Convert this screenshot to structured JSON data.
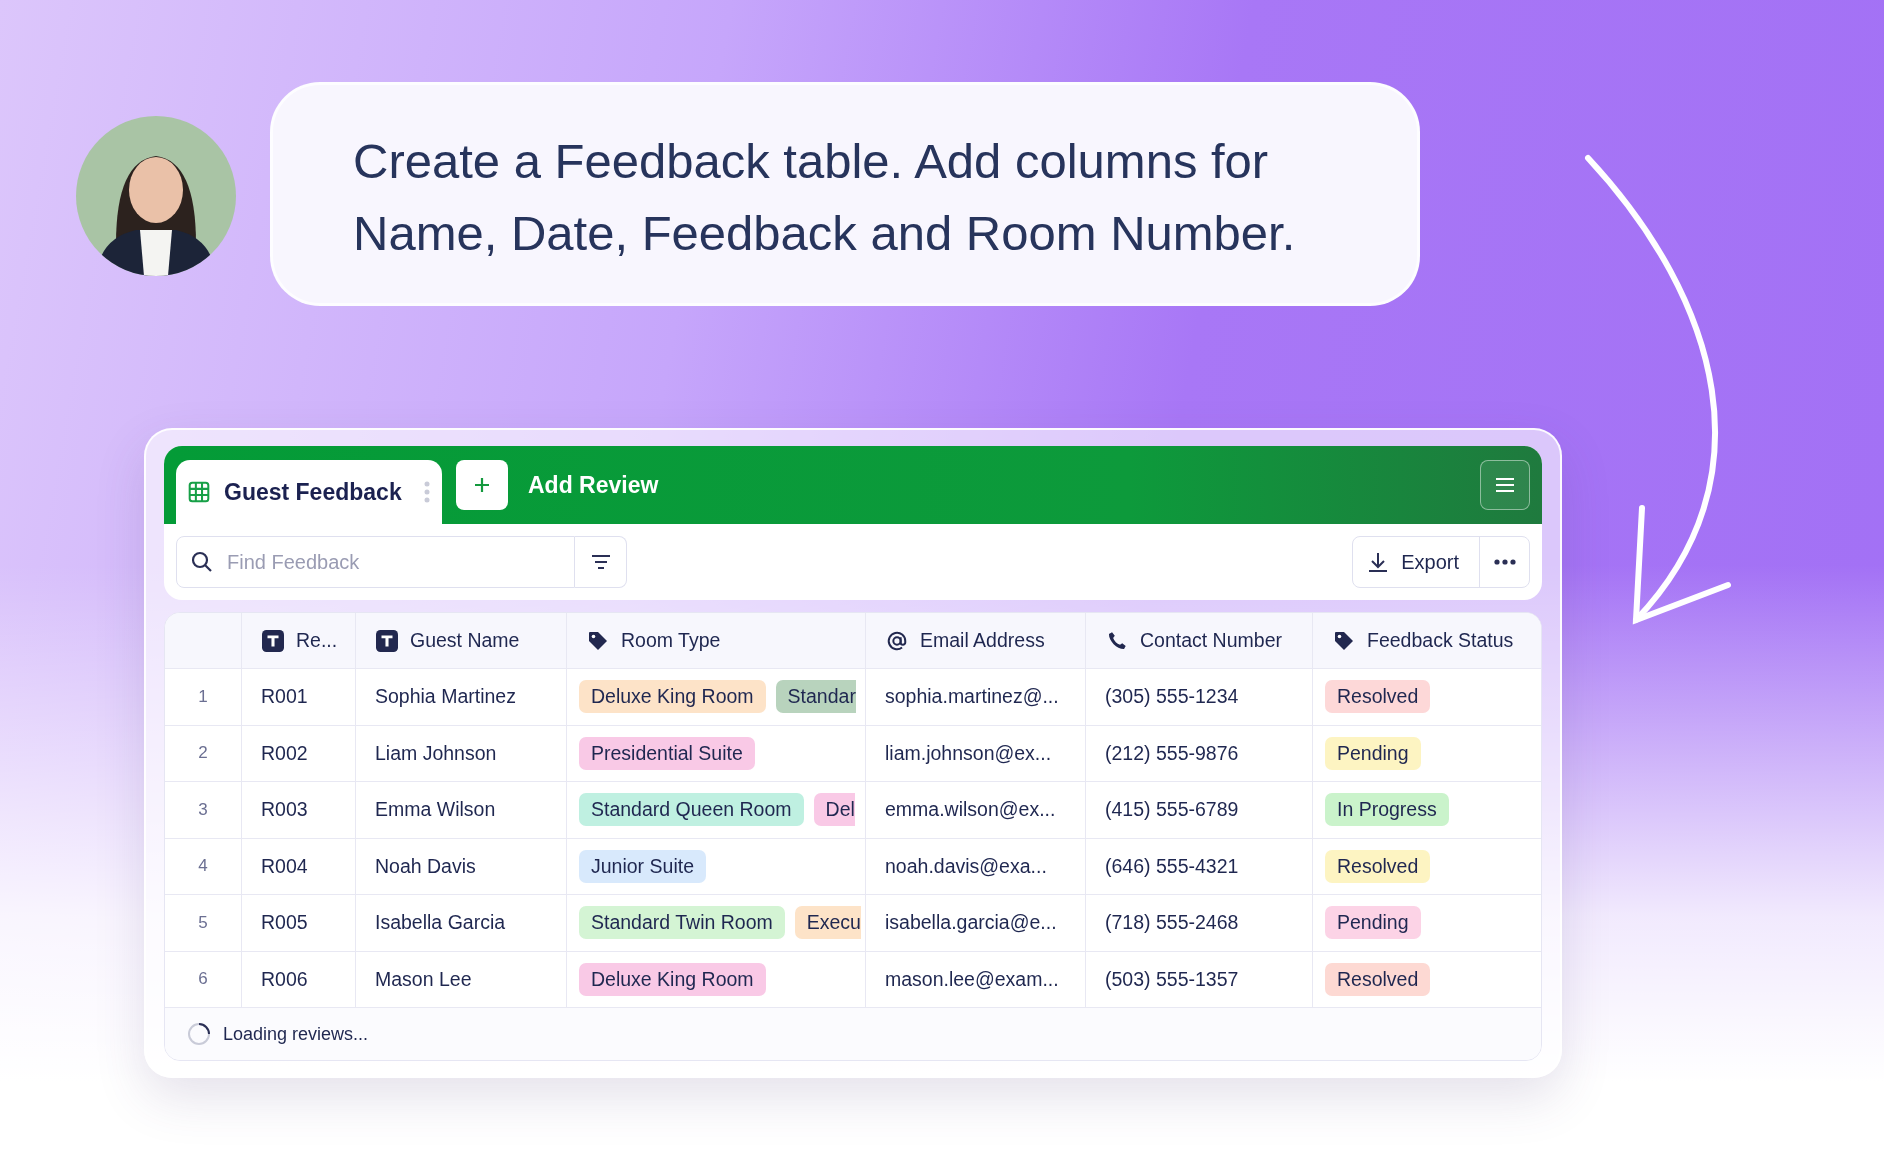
{
  "user_prompt": {
    "text": "Create a Feedback table. Add columns for Name, Date, Feedback and Room Number."
  },
  "table_view": {
    "tabs": [
      {
        "label": "Guest Feedback",
        "selected": true
      }
    ],
    "add_button": {
      "label": "Add Review"
    },
    "search": {
      "placeholder": "Find Feedback"
    },
    "export_button": {
      "label": "Export"
    },
    "columns": [
      {
        "label": "Re...",
        "kind": "text"
      },
      {
        "label": "Guest Name",
        "kind": "text"
      },
      {
        "label": "Room Type",
        "kind": "tag"
      },
      {
        "label": "Email Address",
        "kind": "email"
      },
      {
        "label": "Contact Number",
        "kind": "phone"
      },
      {
        "label": "Feedback Status",
        "kind": "tag"
      }
    ],
    "rows": [
      {
        "number": "1",
        "id": "R001",
        "guest_name": "Sophia Martinez",
        "room_types": [
          {
            "label": "Deluxe King Room",
            "color": "#fde3c8"
          },
          {
            "label": "Standar",
            "color": "#b8d3bd"
          }
        ],
        "email": "sophia.martinez@...",
        "contact": "(305) 555-1234",
        "status": {
          "label": "Resolved",
          "color": "#fdd8d8"
        }
      },
      {
        "number": "2",
        "id": "R002",
        "guest_name": "Liam Johnson",
        "room_types": [
          {
            "label": "Presidential Suite",
            "color": "#f9c9e6"
          }
        ],
        "email": "liam.johnson@ex...",
        "contact": "(212) 555-9876",
        "status": {
          "label": "Pending",
          "color": "#fdf4c2"
        }
      },
      {
        "number": "3",
        "id": "R003",
        "guest_name": "Emma Wilson",
        "room_types": [
          {
            "label": "Standard Queen Room",
            "color": "#bff0e1"
          },
          {
            "label": "Del",
            "color": "#f9c9e6"
          }
        ],
        "email": "emma.wilson@ex...",
        "contact": "(415) 555-6789",
        "status": {
          "label": "In Progress",
          "color": "#caf3cb"
        }
      },
      {
        "number": "4",
        "id": "R004",
        "guest_name": "Noah Davis",
        "room_types": [
          {
            "label": "Junior Suite",
            "color": "#d8e9fc"
          }
        ],
        "email": "noah.davis@exa...",
        "contact": "(646) 555-4321",
        "status": {
          "label": "Resolved",
          "color": "#fdf4c2"
        }
      },
      {
        "number": "5",
        "id": "R005",
        "guest_name": "Isabella Garcia",
        "room_types": [
          {
            "label": "Standard Twin Room",
            "color": "#d4f4d4"
          },
          {
            "label": "Execu",
            "color": "#fde3c8"
          }
        ],
        "email": "isabella.garcia@e...",
        "contact": "(718) 555-2468",
        "status": {
          "label": "Pending",
          "color": "#fcd3e6"
        }
      },
      {
        "number": "6",
        "id": "R006",
        "guest_name": "Mason Lee",
        "room_types": [
          {
            "label": "Deluxe King Room",
            "color": "#f9c9e6"
          }
        ],
        "email": "mason.lee@exam...",
        "contact": "(503) 555-1357",
        "status": {
          "label": "Resolved",
          "color": "#fdd9d3"
        }
      }
    ],
    "footer": {
      "text": "Loading reviews..."
    }
  }
}
